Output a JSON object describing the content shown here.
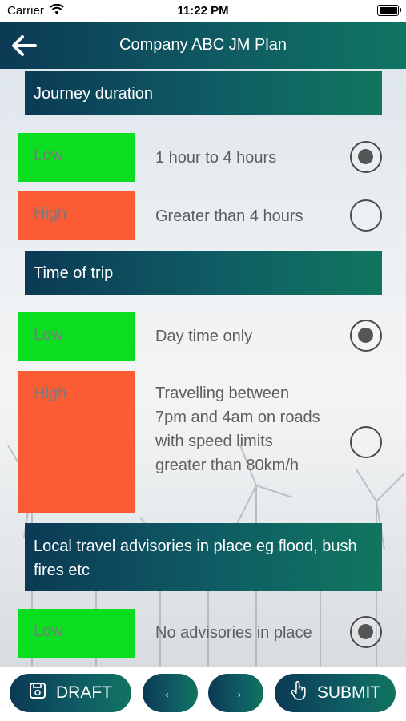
{
  "status_bar": {
    "carrier": "Carrier",
    "time": "11:22 PM"
  },
  "header": {
    "title": "Company ABC JM Plan"
  },
  "sections": [
    {
      "title": "Journey duration",
      "options": [
        {
          "level": "Low",
          "text": "1 hour to 4 hours",
          "selected": true
        },
        {
          "level": "High",
          "text": "Greater than 4 hours",
          "selected": false
        }
      ]
    },
    {
      "title": "Time of trip",
      "options": [
        {
          "level": "Low",
          "text": "Day time only",
          "selected": true
        },
        {
          "level": "High",
          "text": "Travelling between 7pm and 4am on roads with speed limits greater than 80km/h",
          "selected": false
        }
      ]
    },
    {
      "title": "Local travel advisories in place eg flood, bush fires etc",
      "options": [
        {
          "level": "Low",
          "text": "No advisories in place",
          "selected": true
        }
      ]
    }
  ],
  "footer": {
    "draft_label": "DRAFT",
    "prev_label": "←",
    "next_label": "→",
    "submit_label": "SUBMIT"
  },
  "colors": {
    "low": "#0bde20",
    "high": "#fc5c34",
    "header": "#0f5b63"
  }
}
